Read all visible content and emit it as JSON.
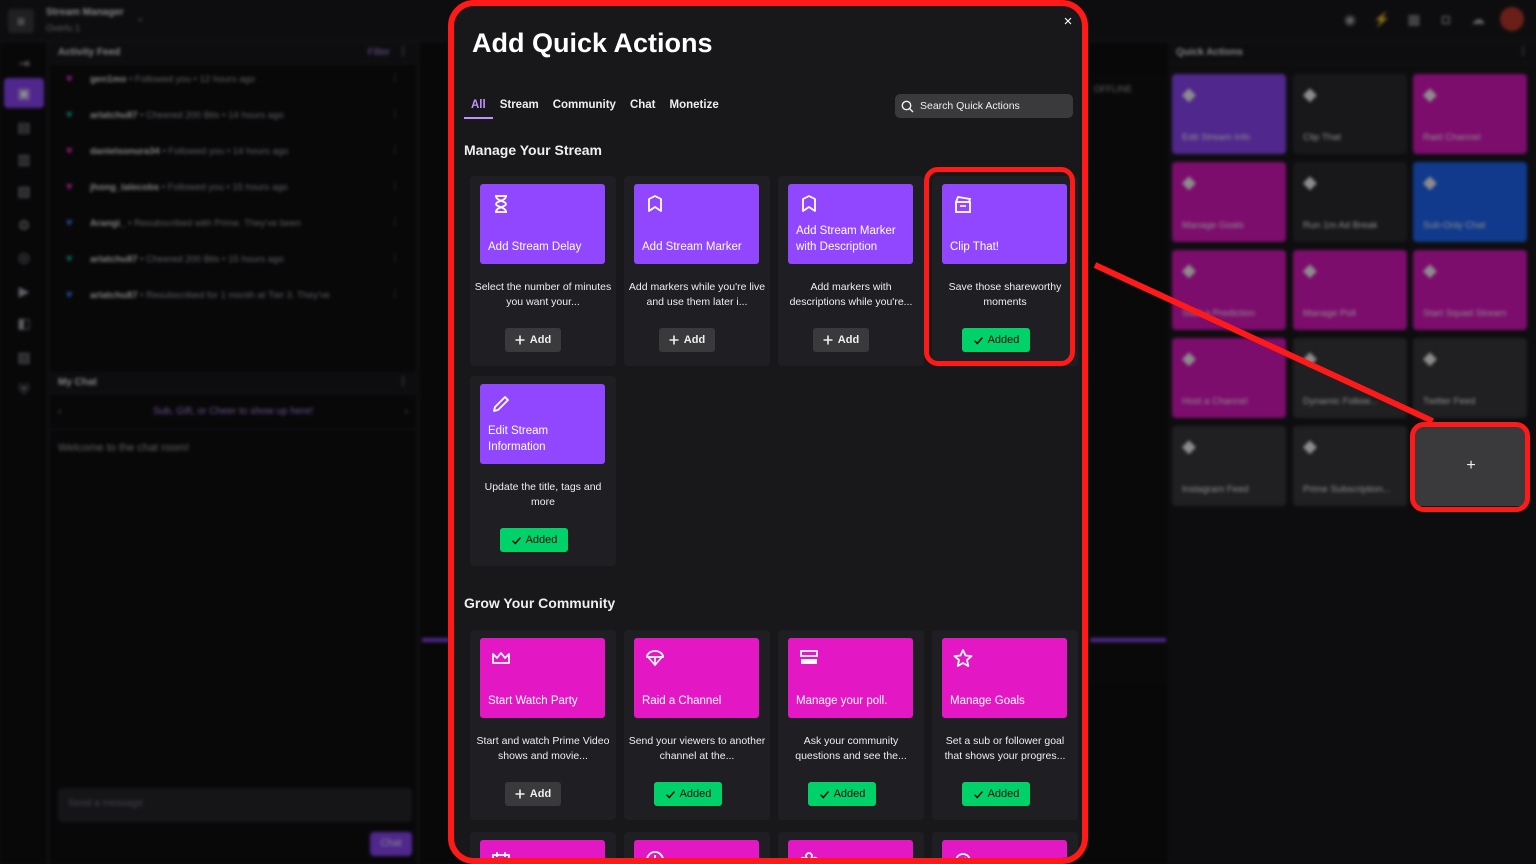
{
  "app": {
    "title": "Stream Manager",
    "subtitle": "Overlu 1",
    "caret": "⌄"
  },
  "activity_feed": {
    "title": "Activity Feed",
    "filter": "Filter",
    "rows": [
      {
        "user": "gen1mo",
        "text": " • Followed you • 12 hours ago",
        "color": "#ff33cc"
      },
      {
        "user": "arlatchu87",
        "text": " • Cheered 200 Bits • 14 hours ago",
        "color": "#1abc9c"
      },
      {
        "user": "danielsonura34",
        "text": " • Followed you • 14 hours ago",
        "color": "#ff33cc"
      },
      {
        "user": "jhong_lalecobs",
        "text": " • Followed you • 15 hours ago",
        "color": "#ff33cc"
      },
      {
        "user": "Arangi_",
        "text": " • Resubscribed with Prime. They've been",
        "color": "#3a8dff"
      },
      {
        "user": "arlatchu87",
        "text": " • Cheered 200 Bits • 15 hours ago",
        "color": "#1abc9c"
      },
      {
        "user": "arlatchu87",
        "text": " • Resubscribed for 1 month at Tier 3. They've",
        "color": "#3a8dff"
      }
    ]
  },
  "my_chat": {
    "title": "My Chat",
    "nav_text": "Sub, Gift, or Cheer to show up here!",
    "welcome": "Welcome to the chat room!",
    "input_placeholder": "Send a message",
    "chat_button": "Chat"
  },
  "video": {
    "status": "OFFLINE"
  },
  "quick_actions_panel": {
    "title": "Quick Actions",
    "tiles": [
      {
        "label": "Edit Stream Info",
        "color": "#9147ff"
      },
      {
        "label": "Clip That",
        "color": "#2b2b30"
      },
      {
        "label": "Raid Channel",
        "color": "#e317c4"
      },
      {
        "label": "Manage Goals",
        "color": "#e317c4"
      },
      {
        "label": "Run 1m Ad Break",
        "color": "#2b2b30"
      },
      {
        "label": "Sub-Only Chat",
        "color": "#1f69ff"
      },
      {
        "label": "Start a Prediction",
        "color": "#e317c4"
      },
      {
        "label": "Manage Poll",
        "color": "#e317c4"
      },
      {
        "label": "Start Squad Stream",
        "color": "#e317c4"
      },
      {
        "label": "Host a Channel",
        "color": "#e317c4"
      },
      {
        "label": "Dynamic Follow...",
        "color": "#3a3a3d"
      },
      {
        "label": "Twitter Feed",
        "color": "#3a3a3d"
      },
      {
        "label": "Instagram Feed",
        "color": "#3a3a3d"
      },
      {
        "label": "Prime Subscription...",
        "color": "#3a3a3d"
      }
    ],
    "plus_label": "+"
  },
  "modal": {
    "title": "Add Quick Actions",
    "close": "×",
    "tabs": [
      "All",
      "Stream",
      "Community",
      "Chat",
      "Monetize"
    ],
    "active_tab": "All",
    "search_placeholder": "Search Quick Actions",
    "sections": [
      {
        "title": "Manage Your Stream",
        "cards": [
          {
            "name": "Add Stream Delay",
            "desc": "Select the number of minutes you want your...",
            "icon": "hourglass-icon",
            "status": "Add"
          },
          {
            "name": "Add Stream Marker",
            "desc": "Add markers while you're live and use them later i...",
            "icon": "marker-icon",
            "status": "Add"
          },
          {
            "name": "Add Stream Marker with Description",
            "desc": "Add markers with descriptions while you're...",
            "icon": "marker-icon",
            "status": "Add"
          },
          {
            "name": "Clip That!",
            "desc": "Save those shareworthy moments",
            "icon": "clapper-icon",
            "status": "Added"
          },
          {
            "name": "Edit Stream Information",
            "desc": "Update the title, tags and more",
            "icon": "pencil-icon",
            "status": "Added"
          }
        ]
      },
      {
        "title": "Grow Your Community",
        "cards": [
          {
            "name": "Start Watch Party",
            "desc": "Start and watch Prime Video shows and movie...",
            "icon": "crown-icon",
            "status": "Add"
          },
          {
            "name": "Raid a Channel",
            "desc": "Send your viewers to another channel at the...",
            "icon": "parachute-icon",
            "status": "Added"
          },
          {
            "name": "Manage your poll.",
            "desc": "Ask your community questions and see the...",
            "icon": "poll-icon",
            "status": "Added"
          },
          {
            "name": "Manage Goals",
            "desc": "Set a sub or follower goal that shows your progres...",
            "icon": "star-icon",
            "status": "Added"
          }
        ]
      }
    ],
    "add_label": "Add",
    "added_label": "Added"
  },
  "colors": {
    "accent": "#9147ff",
    "pink": "#e317c4",
    "added_green": "#00d26a",
    "highlight_red": "#ff1a1a"
  }
}
